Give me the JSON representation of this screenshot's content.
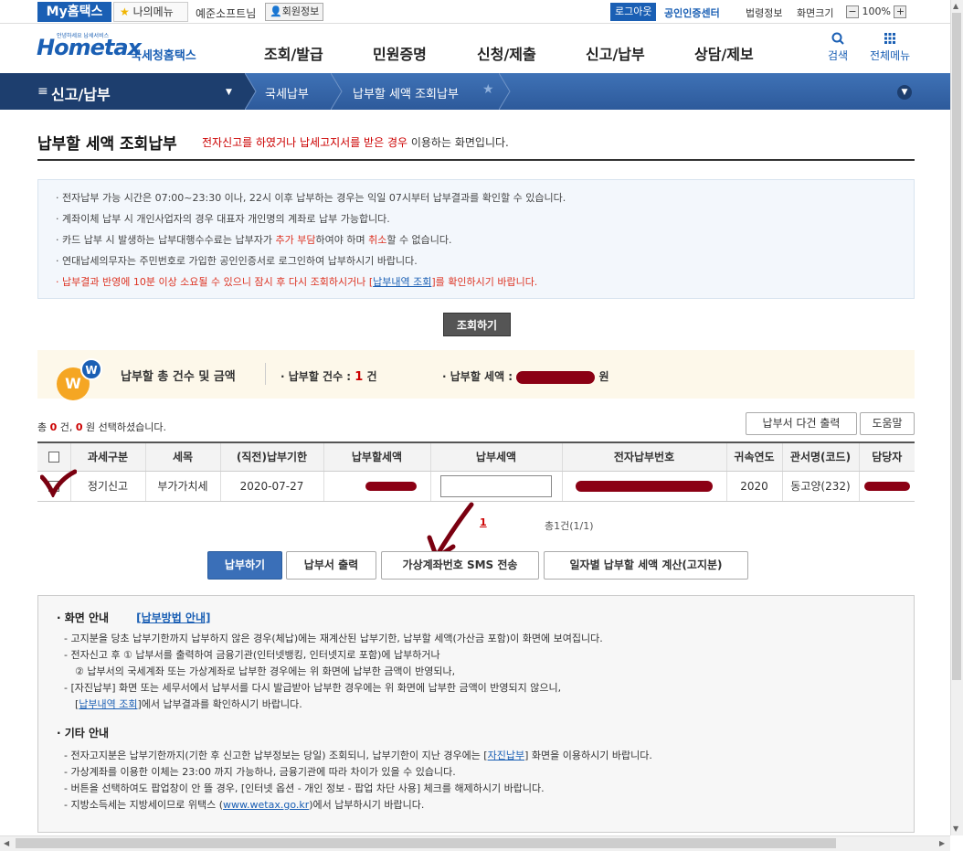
{
  "topbar": {
    "my_hometax": "My홈택스",
    "my_menu": "나의메뉴",
    "username": "예준소프트님",
    "member_info": "회원정보",
    "logout": "로그아웃",
    "cert_center": "공인인증센터",
    "law_info": "법령정보",
    "screen_size": "화면크기",
    "zoom": "100%",
    "zoom_minus": "−",
    "zoom_plus": "+"
  },
  "header": {
    "logo_small": "안녕하세요 납세서비스",
    "logo_main": "Hometax",
    "logo_sub": "국세청홈택스",
    "nav": [
      "조회/발급",
      "민원증명",
      "신청/제출",
      "신고/납부",
      "상담/제보"
    ],
    "search": "검색",
    "all_menu": "전체메뉴"
  },
  "bluenav": {
    "section": "신고/납부",
    "crumb1": "국세납부",
    "crumb2": "납부할 세액 조회납부"
  },
  "page": {
    "title": "납부할 세액 조회납부",
    "sub_red": "전자신고를 하였거나 납세고지서를 받은 경우",
    "sub_rest": " 이용하는 화면입니다."
  },
  "notice": {
    "line1": "전자납부 가능 시간은 07:00~23:30 이나, 22시 이후 납부하는 경우는 익일 07시부터 납부결과를 확인할 수 있습니다.",
    "line2": "계좌이체 납부 시 개인사업자의 경우 대표자 개인명의 계좌로 납부 가능합니다.",
    "line3a": "카드 납부 시 발생하는 납부대행수수료는 납부자가 ",
    "line3b": "추가 부담",
    "line3c": "하여야 하며 ",
    "line3d": "취소",
    "line3e": "할 수 없습니다.",
    "line4": "연대납세의무자는 주민번호로 가입한 공인인증서로 로그인하여 납부하시기 바랍니다.",
    "line5a": "납부결과 반영에 10분 이상 소요될 수 있으니 잠시 후 다시 조회하시거나 [",
    "line5b": "납부내역 조회",
    "line5c": "]를 확인하시기 바랍니다."
  },
  "query_button": "조회하기",
  "summary": {
    "icon_w1": "W",
    "icon_w2": "W",
    "label": "납부할 총 건수 및 금액",
    "count_label": "납부할 건수 : ",
    "count_value": "1",
    "count_unit": " 건",
    "amount_label": "납부할 세액 : ",
    "amount_unit": " 원"
  },
  "selection": {
    "prefix": "총 ",
    "count": "0",
    "mid": " 건, ",
    "amount": "0",
    "suffix": " 원 선택하셨습니다."
  },
  "buttons": {
    "multi_print": "납부서 다건 출력",
    "help": "도움말",
    "pay": "납부하기",
    "print": "납부서 출력",
    "sms": "가상계좌번호 SMS 전송",
    "daily": "일자별 납부할 세액 계산(고지분)"
  },
  "table": {
    "headers": [
      "",
      "과세구분",
      "세목",
      "(직전)납부기한",
      "납부할세액",
      "납부세액",
      "전자납부번호",
      "귀속연도",
      "관서명(코드)",
      "담당자"
    ],
    "rows": [
      {
        "type": "정기신고",
        "tax": "부가가치세",
        "due": "2020-07-27",
        "year": "2020",
        "office": "동고양(232)"
      }
    ]
  },
  "pagination": {
    "current": "1",
    "total": "총1건(1/1)"
  },
  "guide": {
    "screen_title": "화면 안내",
    "screen_link": "[납부방법 안내]",
    "s1": "- 고지분을 당초 납부기한까지 납부하지 않은 경우(체납)에는 재계산된 납부기한, 납부할 세액(가산금 포함)이 화면에 보여집니다.",
    "s2": "- 전자신고 후 ① 납부서를 출력하여 금융기관(인터넷뱅킹, 인터넷지로 포함)에 납부하거나",
    "s3": "② 납부서의 국세계좌 또는 가상계좌로 납부한 경우에는 위 화면에 납부한 금액이 반영되나,",
    "s4": "- [자진납부] 화면 또는 세무서에서 납부서를 다시 발급받아 납부한 경우에는 위 화면에 납부한 금액이 반영되지 않으니,",
    "s5a": "[",
    "s5b": "납부내역 조회",
    "s5c": "]에서 납부결과를 확인하시기 바랍니다.",
    "etc_title": "기타 안내",
    "e1a": "- 전자고지분은 납부기한까지(기한 후 신고한 납부정보는 당일) 조회되니, 납부기한이 지난 경우에는 [",
    "e1b": "자진납부",
    "e1c": "] 화면을 이용하시기 바랍니다.",
    "e2": "- 가상계좌를 이용한 이체는 23:00 까지 가능하나, 금융기관에 따라 차이가 있을 수 있습니다.",
    "e3": "- 버튼을 선택하여도 팝업창이 안 뜰 경우, [인터넷 옵션 - 개인 정보 - 팝업 차단 사용] 체크를 해제하시기 바랍니다.",
    "e4a": "- 지방소득세는 지방세이므로 위택스 (",
    "e4b": "www.wetax.go.kr",
    "e4c": ")에서 납부하시기 바랍니다."
  },
  "colors": {
    "brand_blue": "#1a5fb4",
    "nav_blue": "#2d5a9b",
    "accent_red": "#cc0000",
    "redaction": "#8b0014"
  }
}
